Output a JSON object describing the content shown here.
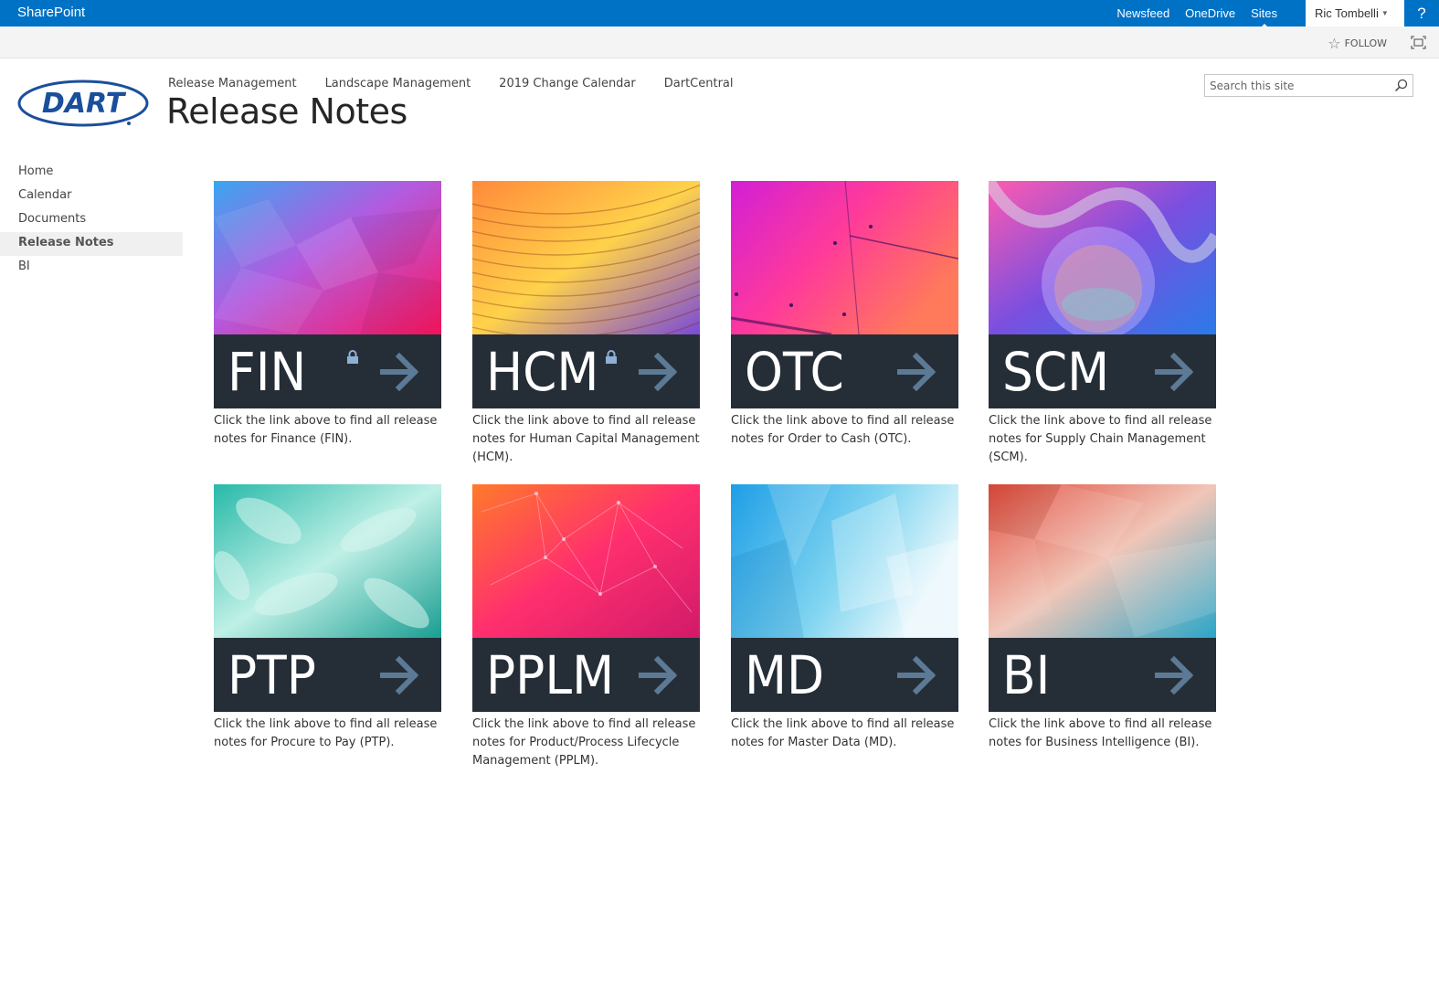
{
  "suitebar": {
    "brand": "SharePoint",
    "links": [
      "Newsfeed",
      "OneDrive",
      "Sites"
    ],
    "active_link": "Sites",
    "user": "Ric Tombelli",
    "help": "?",
    "colors": {
      "bar": "#0072c6"
    }
  },
  "ribbon": {
    "follow_label": "FOLLOW"
  },
  "header": {
    "logo_text": "DART",
    "topnav": [
      "Release Management",
      "Landscape Management",
      "2019 Change Calendar",
      "DartCentral"
    ],
    "title": "Release Notes",
    "search_placeholder": "Search this site"
  },
  "leftnav": {
    "items": [
      "Home",
      "Calendar",
      "Documents",
      "Release Notes",
      "BI"
    ],
    "selected": "Release Notes"
  },
  "tiles": [
    {
      "code": "FIN",
      "locked": true,
      "desc": "Click the link above to find all release notes for Finance (FIN)."
    },
    {
      "code": "HCM",
      "locked": true,
      "desc": "Click the link above to find all release notes for Human Capital Management (HCM)."
    },
    {
      "code": "OTC",
      "locked": false,
      "desc": "Click the link above to find all release notes for Order to Cash (OTC)."
    },
    {
      "code": "SCM",
      "locked": false,
      "desc": "Click the link above to find all release notes for Supply Chain Management (SCM)."
    },
    {
      "code": "PTP",
      "locked": false,
      "desc": "Click the link above to find all release notes for Procure to Pay (PTP)."
    },
    {
      "code": "PPLM",
      "locked": false,
      "desc": "Click the link above to find all release notes for Product/Process Lifecycle Management (PPLM)."
    },
    {
      "code": "MD",
      "locked": false,
      "desc": "Click the link above to find all release notes for Master Data (MD)."
    },
    {
      "code": "BI",
      "locked": false,
      "desc": "Click the link above to find all release notes for Business Intelligence (BI)."
    }
  ]
}
